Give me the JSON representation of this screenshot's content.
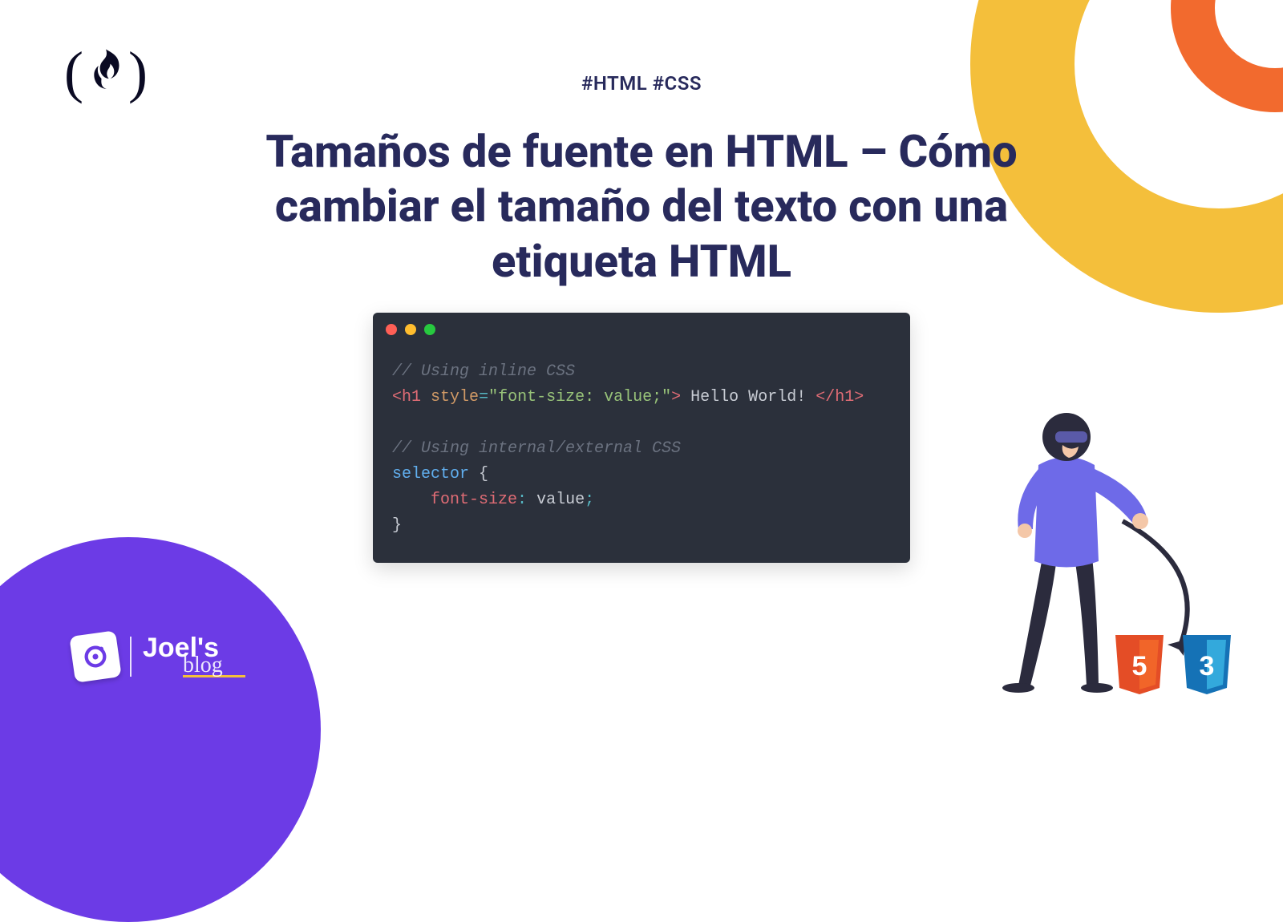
{
  "tags": "#HTML #CSS",
  "title": "Tamaños de fuente en HTML – Cómo cambiar el tamaño del texto con una etiqueta HTML",
  "code": {
    "comment1": "// Using inline CSS",
    "line2": {
      "open_angle": "<",
      "tag": "h1",
      "attr": "style",
      "eq": "=",
      "str_open": "\"",
      "str_content": "font-size: value;",
      "str_close": "\"",
      "close_angle": ">",
      "text": " Hello World! ",
      "close_open_angle": "</",
      "close_tag": "h1",
      "close_close_angle": ">"
    },
    "comment2": "// Using internal/external CSS",
    "selector": "selector ",
    "brace_open": "{",
    "prop": "font-size",
    "colon": ": ",
    "value": "value",
    "semicolon": ";",
    "brace_close": "}"
  },
  "branding": {
    "joels": "Joel's",
    "blog": "blog"
  },
  "shields": {
    "html": "5",
    "css": "3"
  }
}
